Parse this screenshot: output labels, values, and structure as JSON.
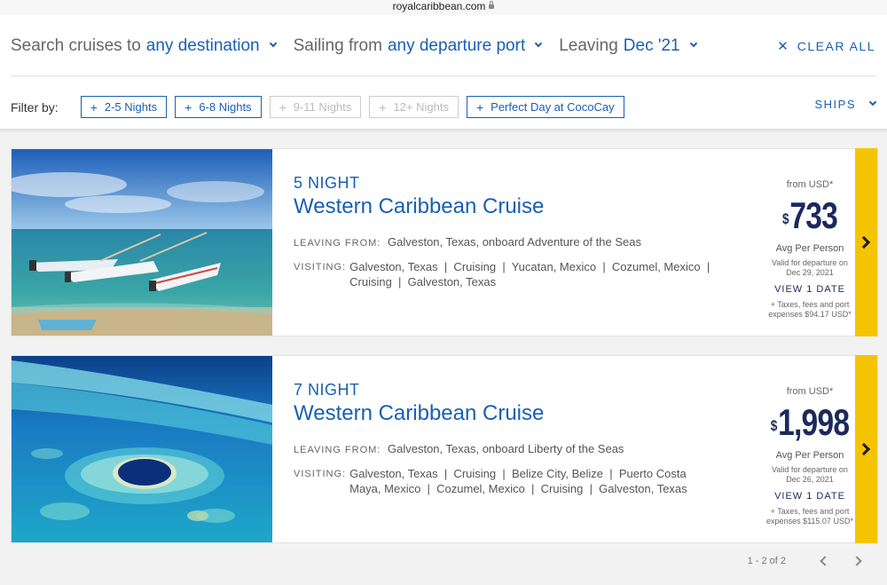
{
  "browser": {
    "url": "royalcaribbean.com"
  },
  "search": {
    "destination_prefix": "Search cruises to",
    "destination_value": "any destination",
    "port_prefix": "Sailing from",
    "port_value": "any departure port",
    "date_prefix": "Leaving",
    "date_value": "Dec '21",
    "clear_all": "CLEAR ALL"
  },
  "filters": {
    "label": "Filter by:",
    "chips": [
      {
        "label": "2-5 Nights",
        "enabled": true
      },
      {
        "label": "6-8 Nights",
        "enabled": true
      },
      {
        "label": "9-11 Nights",
        "enabled": false
      },
      {
        "label": "12+ Nights",
        "enabled": false
      },
      {
        "label": "Perfect Day at CocoCay",
        "enabled": true
      }
    ],
    "ships": "SHIPS"
  },
  "results": [
    {
      "nights": "5 NIGHT",
      "name": "Western Caribbean Cruise",
      "leaving_label": "LEAVING FROM:",
      "leaving": "Galveston, Texas, onboard Adventure of the Seas",
      "visiting_label": "VISITING:",
      "visiting": "Galveston, Texas  |  Cruising  |  Yucatan, Mexico  |  Cozumel, Mexico  |  Cruising  |  Galveston, Texas",
      "from": "from USD*",
      "currency": "$",
      "price": "733",
      "avg": "Avg Per Person",
      "valid_line1": "Valid for departure on",
      "valid_line2": "Dec 29, 2021",
      "view_dates": "VIEW 1 DATE",
      "taxes_line1": "+ Taxes, fees and port",
      "taxes_line2": "expenses $94.17 USD*"
    },
    {
      "nights": "7 NIGHT",
      "name": "Western Caribbean Cruise",
      "leaving_label": "LEAVING FROM:",
      "leaving": "Galveston, Texas, onboard Liberty of the Seas",
      "visiting_label": "VISITING:",
      "visiting": "Galveston, Texas  |  Cruising  |  Belize City, Belize  |  Puerto Costa Maya, Mexico  |  Cozumel, Mexico  |  Cruising  |  Galveston, Texas",
      "from": "from USD*",
      "currency": "$",
      "price": "1,998",
      "avg": "Avg Per Person",
      "valid_line1": "Valid for departure on",
      "valid_line2": "Dec 26, 2021",
      "view_dates": "VIEW 1 DATE",
      "taxes_line1": "+ Taxes, fees and port",
      "taxes_line2": "expenses $115.07 USD*"
    }
  ],
  "pagination": {
    "range": "1 - 2 of 2"
  },
  "colors": {
    "brand_blue": "#1a5fb4",
    "price_navy": "#1b2a5c",
    "accent_yellow": "#f5c400"
  }
}
